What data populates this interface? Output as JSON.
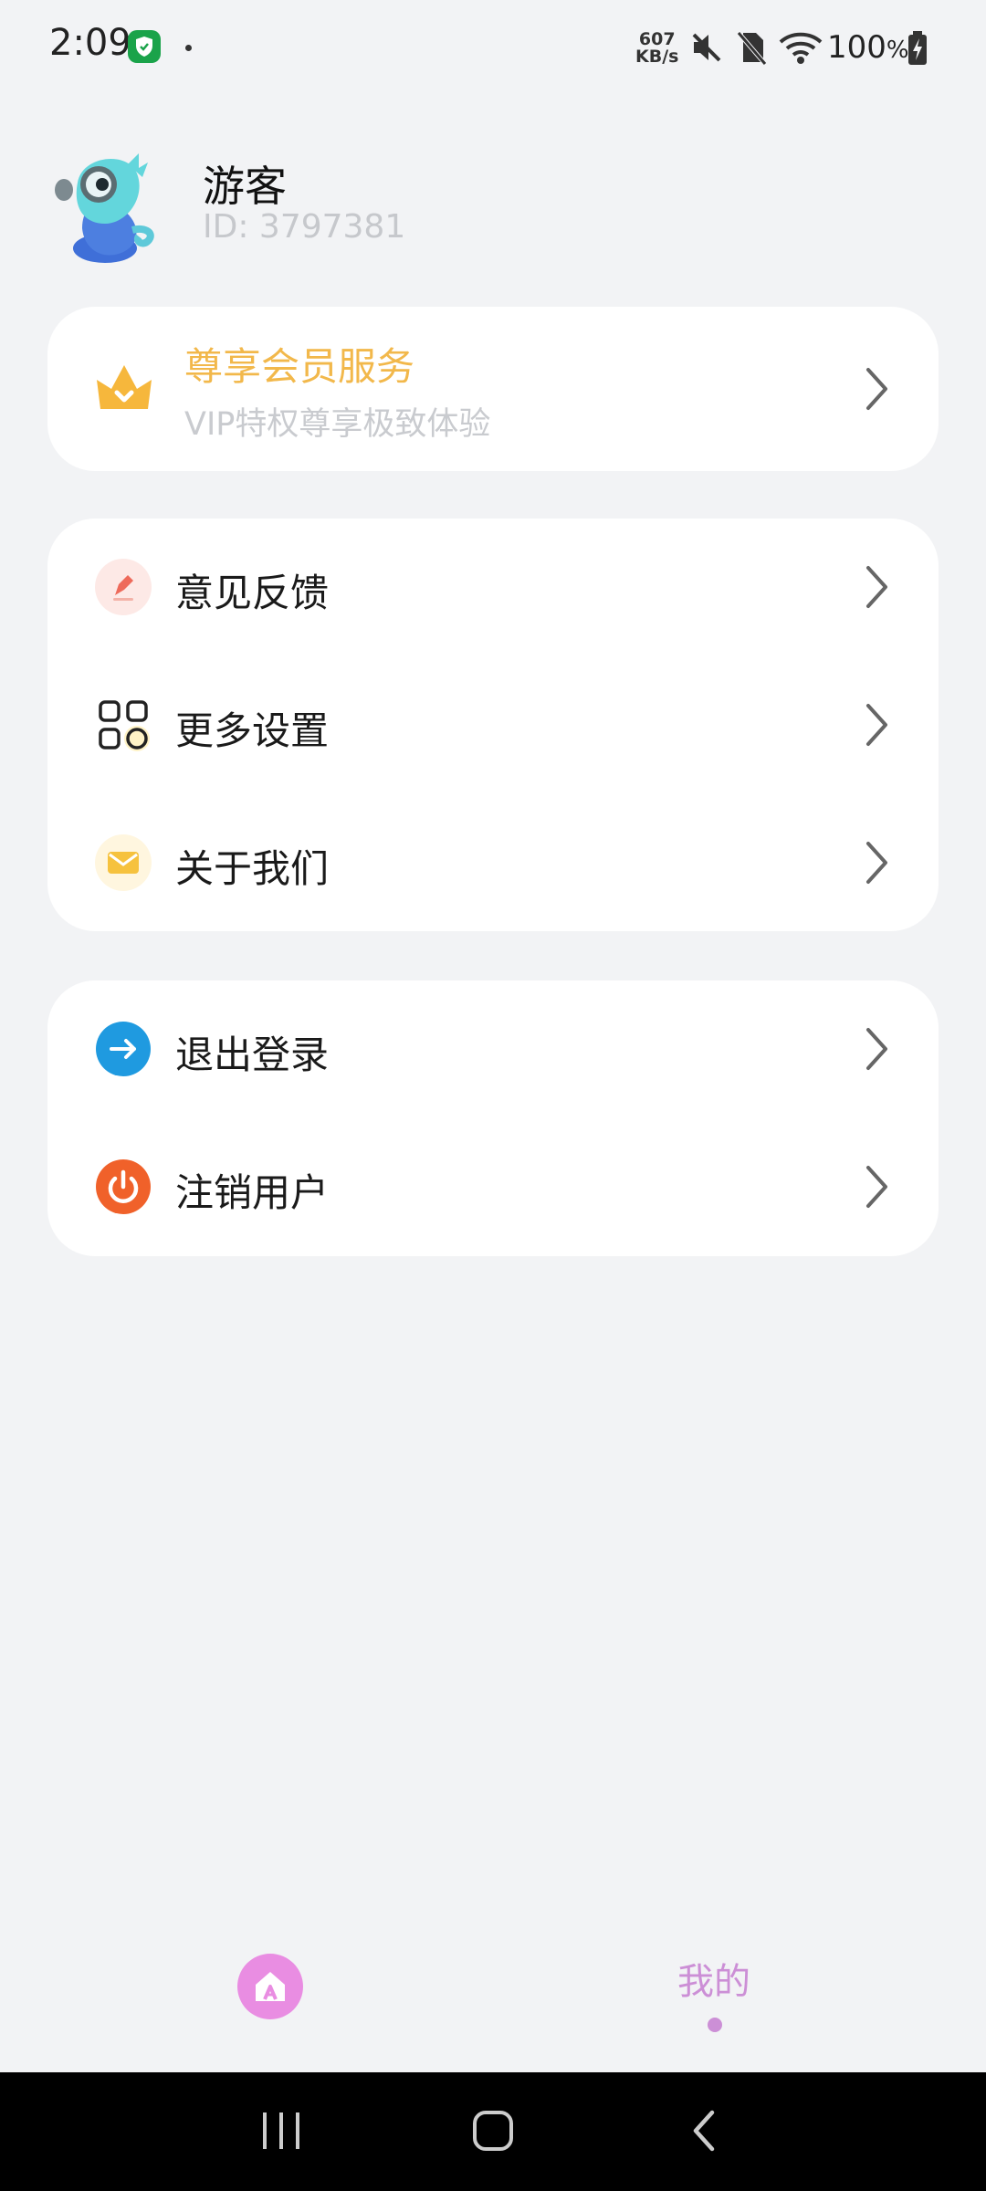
{
  "status_bar": {
    "time": "2:09",
    "net_speed_top": "607",
    "net_speed_bottom": "KB/s",
    "battery_value": "100",
    "battery_unit": "%"
  },
  "profile": {
    "name": "游客",
    "id": "ID: 3797381"
  },
  "vip": {
    "title": "尊享会员服务",
    "subtitle": "VIP特权尊享极致体验"
  },
  "menu": {
    "items": [
      {
        "label": "意见反馈",
        "icon": "feedback-icon"
      },
      {
        "label": "更多设置",
        "icon": "grid-settings-icon"
      },
      {
        "label": "关于我们",
        "icon": "mail-icon"
      }
    ]
  },
  "account": {
    "items": [
      {
        "label": "退出登录",
        "icon": "logout-arrow-icon"
      },
      {
        "label": "注销用户",
        "icon": "power-icon"
      }
    ]
  },
  "bottom_nav": {
    "mine_label": "我的"
  },
  "colors": {
    "background": "#f2f3f5",
    "vip_gold": "#f2b84b",
    "accent_pink": "#cc8fd6",
    "logout_blue": "#1f9ae0",
    "power_orange": "#f0612a"
  }
}
